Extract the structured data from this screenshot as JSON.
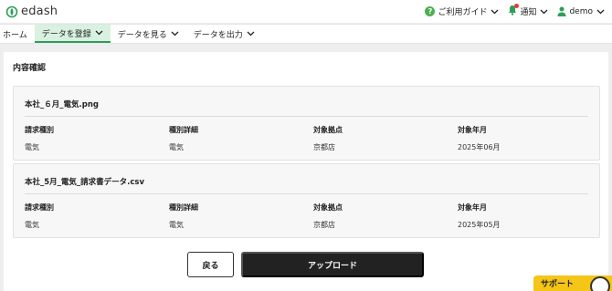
{
  "app": {
    "logo_text": "edash"
  },
  "header": {
    "help_label": "ご利用ガイド",
    "notify_label": "通知",
    "user_label": "demo"
  },
  "nav": {
    "items": [
      {
        "label": "ホーム"
      },
      {
        "label": "データを登録"
      },
      {
        "label": "データを見る"
      },
      {
        "label": "データを出力"
      }
    ],
    "active": "データを登録"
  },
  "main": {
    "title": "内容確認",
    "field_labels": {
      "billing_type": "請求種別",
      "type_detail": "種別詳細",
      "site": "対象拠点",
      "period": "対象年月"
    },
    "files": [
      {
        "name": "本社_６月_電気.png",
        "billing_type": "電気",
        "type_detail": "電気",
        "site": "京都店",
        "period": "2025年06月"
      },
      {
        "name": "本社_5月_電気_請求書データ.csv",
        "billing_type": "電気",
        "type_detail": "電気",
        "site": "京都店",
        "period": "2025年05月"
      }
    ],
    "back_label": "戻る",
    "upload_label": "アップロード"
  },
  "support": {
    "label": "サポート"
  },
  "colors": {
    "accent_green": "#2e9e5a",
    "active_tab_bg": "#d9f1e1",
    "notify_dot": "#e53935",
    "support_bg": "#f5c518",
    "primary_button": "#222222"
  }
}
